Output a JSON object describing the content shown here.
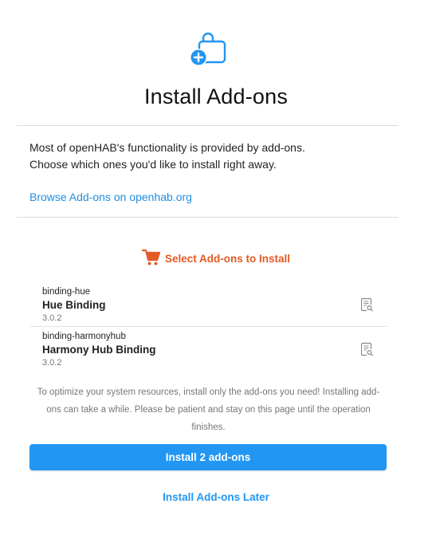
{
  "hero": {
    "icon": "shopping-bag-add-icon",
    "color": "#2196f3"
  },
  "title": "Install Add-ons",
  "intro": {
    "line1": "Most of openHAB's functionality is provided by add-ons.",
    "line2": "Choose which ones you'd like to install right away."
  },
  "browse_link": "Browse Add-ons on openhab.org",
  "select_heading": {
    "label": "Select Add-ons to Install",
    "icon": "cart-icon",
    "color": "#e35a24"
  },
  "addons": [
    {
      "id": "binding-hue",
      "name": "Hue Binding",
      "version": "3.0.2",
      "icon": "documentation-icon"
    },
    {
      "id": "binding-harmonyhub",
      "name": "Harmony Hub Binding",
      "version": "3.0.2",
      "icon": "documentation-icon"
    }
  ],
  "notice": {
    "line1": "To optimize your system resources, install only the add-ons you need! Installing add-",
    "line2": "ons can take a while. Please be patient and stay on this page until the operation",
    "line3": "finishes."
  },
  "install_button": "Install 2 add-ons",
  "later_link": "Install Add-ons Later"
}
